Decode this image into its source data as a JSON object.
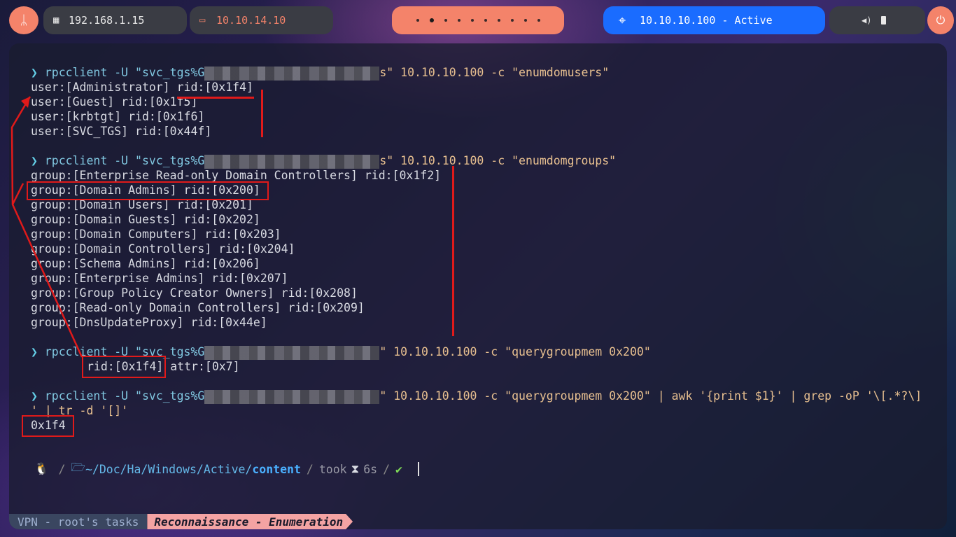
{
  "topbar": {
    "launcher_icon": "kali-dragon-icon",
    "local_ip": "192.168.1.15",
    "vpn_ip": "10.10.14.10",
    "target": "10.10.10.100 - Active",
    "colors": {
      "accent": "#f4836a",
      "target": "#1a6cff",
      "pill": "#3a3c44"
    }
  },
  "terminal": {
    "cmd1": {
      "prefix": "rpcclient -U \"svc_tgs%G",
      "suffix": "s\" 10.10.10.100 -c \"enumdomusers\""
    },
    "users": [
      "user:[Administrator] rid:[0x1f4]",
      "user:[Guest] rid:[0x1f5]",
      "user:[krbtgt] rid:[0x1f6]",
      "user:[SVC_TGS] rid:[0x44f]"
    ],
    "cmd2": {
      "prefix": "rpcclient -U \"svc_tgs%G",
      "suffix": "s\" 10.10.10.100 -c \"enumdomgroups\""
    },
    "groups": [
      "group:[Enterprise Read-only Domain Controllers] rid:[0x1f2]",
      "group:[Domain Admins] rid:[0x200]",
      "group:[Domain Users] rid:[0x201]",
      "group:[Domain Guests] rid:[0x202]",
      "group:[Domain Computers] rid:[0x203]",
      "group:[Domain Controllers] rid:[0x204]",
      "group:[Schema Admins] rid:[0x206]",
      "group:[Enterprise Admins] rid:[0x207]",
      "group:[Group Policy Creator Owners] rid:[0x208]",
      "group:[Read-only Domain Controllers] rid:[0x209]",
      "group:[DnsUpdateProxy] rid:[0x44e]"
    ],
    "cmd3": {
      "prefix": "rpcclient -U \"svc_tgs%G",
      "suffix": "\" 10.10.10.100 -c \"querygroupmem 0x200\""
    },
    "member": {
      "rid": "rid:[0x1f4]",
      "attr": " attr:[0x7]"
    },
    "cmd4": {
      "prefix": "rpcclient -U \"svc_tgs%G",
      "suffix": "\" 10.10.10.100 -c \"querygroupmem 0x200\" | awk '{print $1}' | grep -oP '\\[.*?\\]",
      "wrap": "' | tr -d '[]'"
    },
    "result": "0x1f4",
    "prompt": {
      "path_home": "~/Doc/Ha/Windows/Active/",
      "path_current": "content",
      "took_label": "took",
      "duration": "6s"
    }
  },
  "statusbar": {
    "vpn_tab": "VPN - root's tasks",
    "task_tab": "Reconnaissance - Enumeration"
  }
}
